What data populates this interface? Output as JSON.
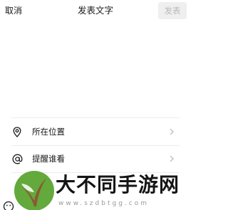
{
  "header": {
    "cancel_label": "取消",
    "title": "发表文字",
    "publish_label": "发表"
  },
  "compose": {
    "value": ""
  },
  "options": [
    {
      "label": "所在位置",
      "icon": "location-pin-icon"
    },
    {
      "label": "提醒谁看",
      "icon": "at-sign-icon"
    }
  ],
  "watermark": {
    "title": "大不同手游网",
    "url": "www.szdbtgg.com"
  },
  "colors": {
    "publish_bg": "#efefef",
    "publish_text": "#b9b9b9",
    "divider": "#ececec",
    "watermark_green": "#63a93b"
  }
}
